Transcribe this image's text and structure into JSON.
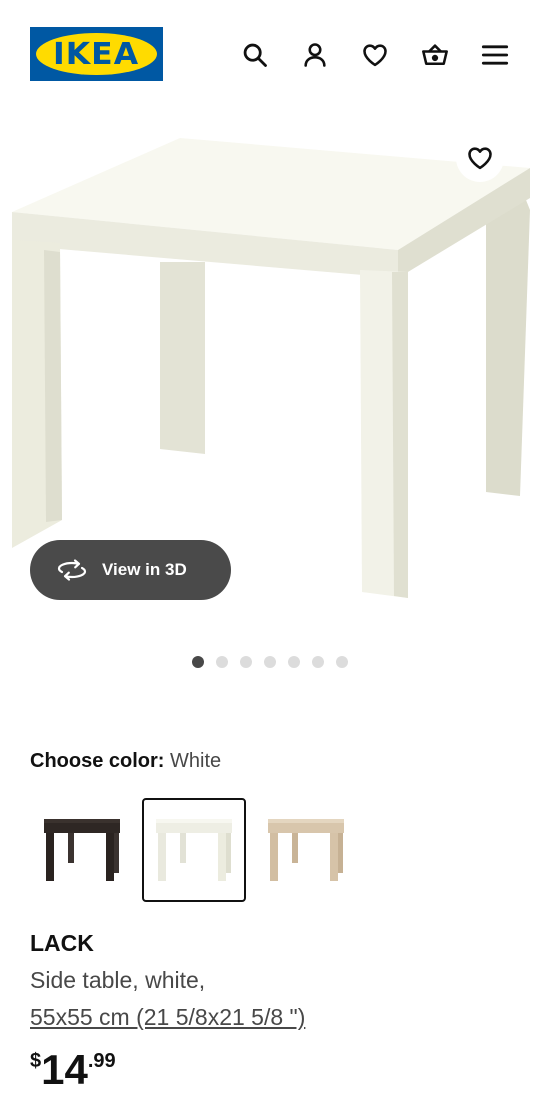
{
  "brand": {
    "logo_text": "IKEA",
    "blue": "#0058a3",
    "yellow": "#ffdb00"
  },
  "header": {
    "icons": [
      "search-icon",
      "account-icon",
      "favorites-icon",
      "cart-icon",
      "menu-icon"
    ]
  },
  "gallery": {
    "view_3d_label": "View in 3D",
    "image_count": 7,
    "active_index": 0
  },
  "color_chooser": {
    "label": "Choose color:",
    "selected_value": "White",
    "options": [
      {
        "name": "Black-brown",
        "color": "#2e2724",
        "selected": false
      },
      {
        "name": "White",
        "color": "#f3f3ee",
        "selected": true
      },
      {
        "name": "White stained oak effect",
        "color": "#d6c3a8",
        "selected": false
      }
    ]
  },
  "product": {
    "name": "LACK",
    "description": "Side table, white,",
    "size": "55x55 cm (21 5/8x21 5/8 \")",
    "price": {
      "currency": "$",
      "integer": "14",
      "decimal": ".99"
    }
  }
}
